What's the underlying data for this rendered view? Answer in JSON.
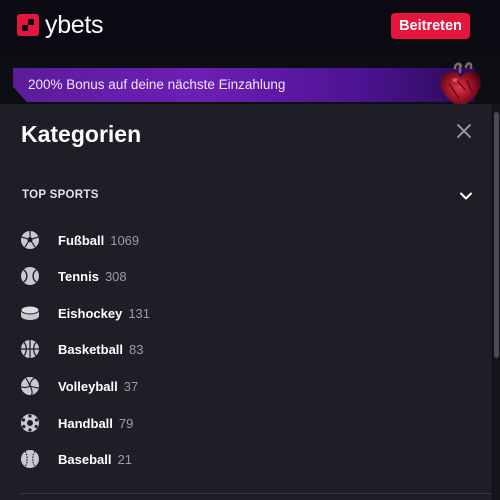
{
  "header": {
    "logo_text": "ybets",
    "join_label": "Beitreten",
    "accent_color": "#e4163d"
  },
  "promo": {
    "text": "200% Bonus auf deine nächste Einzahlung",
    "icon": "heart-icon"
  },
  "categories": {
    "title": "Kategorien",
    "close_icon": "close-icon",
    "section_label": "TOP SPORTS",
    "section_icon": "chevron-down-icon",
    "sports": [
      {
        "name": "Fußball",
        "count": "1069",
        "icon": "soccer-ball-icon"
      },
      {
        "name": "Tennis",
        "count": "308",
        "icon": "tennis-ball-icon"
      },
      {
        "name": "Eishockey",
        "count": "131",
        "icon": "hockey-puck-icon"
      },
      {
        "name": "Basketball",
        "count": "83",
        "icon": "basketball-icon"
      },
      {
        "name": "Volleyball",
        "count": "37",
        "icon": "volleyball-icon"
      },
      {
        "name": "Handball",
        "count": "79",
        "icon": "handball-icon"
      },
      {
        "name": "Baseball",
        "count": "21",
        "icon": "baseball-icon"
      }
    ]
  }
}
